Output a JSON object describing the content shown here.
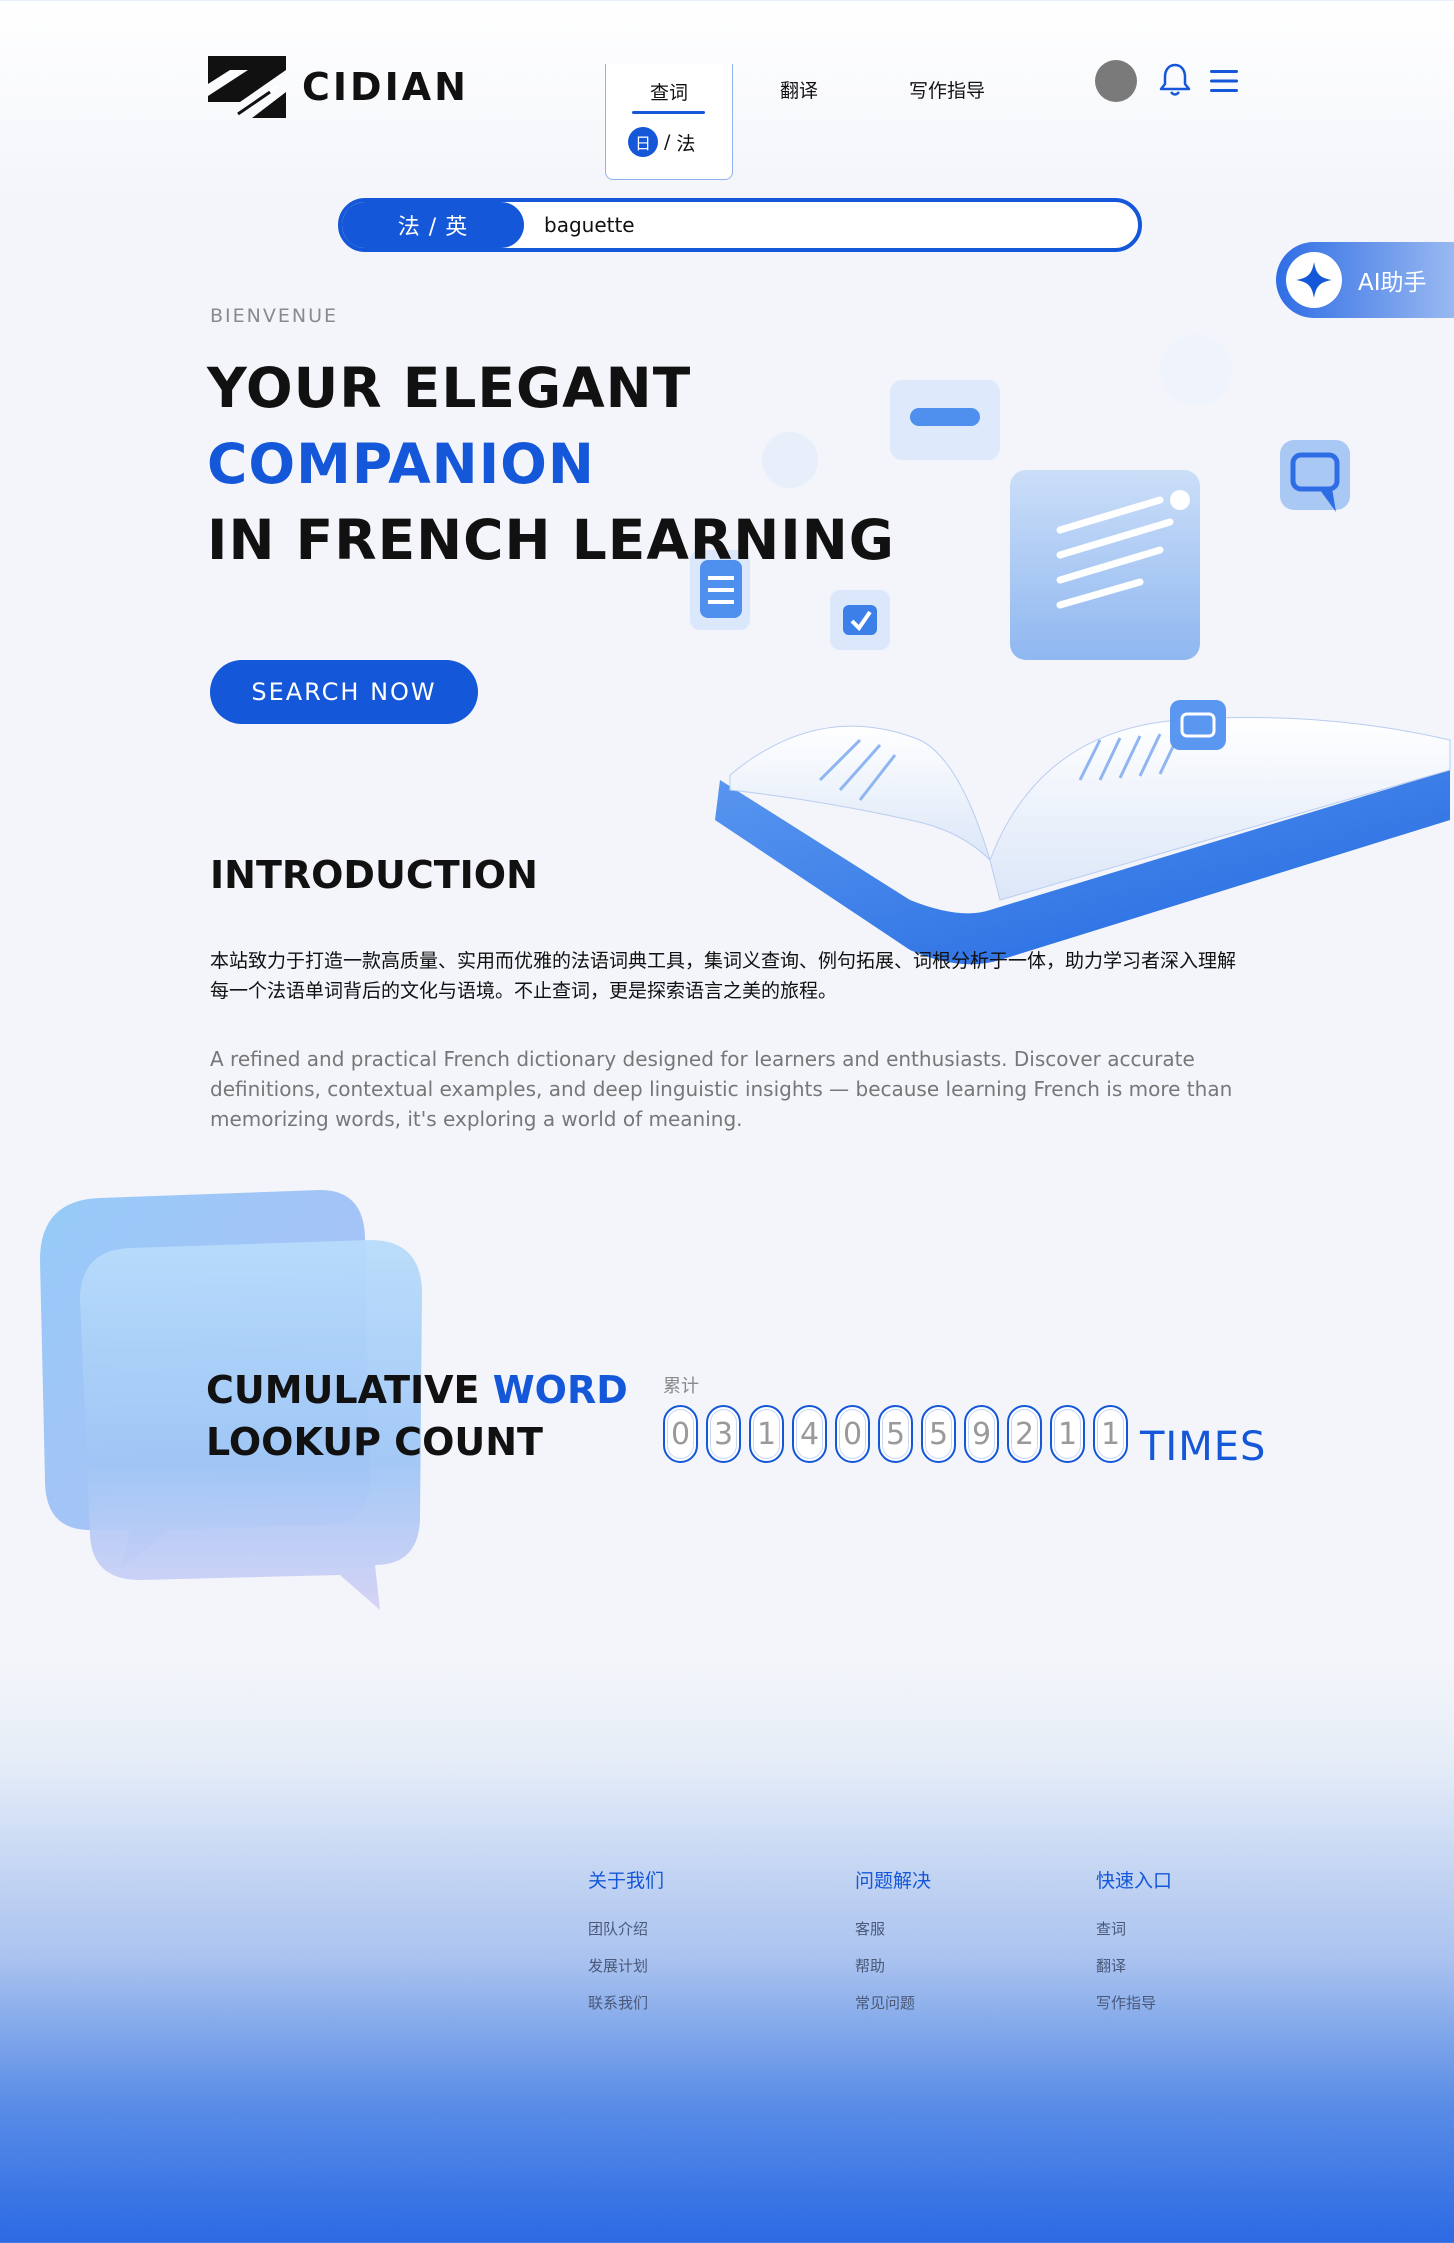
{
  "brand": {
    "name": "CIDIAN"
  },
  "nav": {
    "lookup": "查词",
    "lang_badge": "日",
    "lang_sep": "/",
    "lang_target": "法",
    "translate": "翻译",
    "writing": "写作指导"
  },
  "search": {
    "lang_pair": "法 / 英",
    "value": "baguette"
  },
  "ai_assistant": {
    "label": "AI助手"
  },
  "hero": {
    "eyebrow": "BIENVENUE",
    "line1": "YOUR ELEGANT",
    "line2": "COMPANION",
    "line3": "IN FRENCH LEARNING",
    "cta": "SEARCH NOW"
  },
  "intro": {
    "title": "INTRODUCTION",
    "zh": "本站致力于打造一款高质量、实用而优雅的法语词典工具，集词义查询、例句拓展、词根分析于一体，助力学习者深入理解每一个法语单词背后的文化与语境。不止查词，更是探索语言之美的旅程。",
    "en": "A refined and practical French dictionary designed for learners and enthusiasts. Discover accurate definitions, contextual examples, and deep linguistic insights — because learning French is more than memorizing words, it's exploring a world of meaning."
  },
  "counter": {
    "title_part1": "CUMULATIVE",
    "title_part2": "WORD",
    "title_line2": "LOOKUP COUNT",
    "caption": "累计",
    "digits": [
      "0",
      "3",
      "1",
      "4",
      "0",
      "5",
      "5",
      "9",
      "2",
      "1",
      "1"
    ],
    "unit": "TIMES"
  },
  "footer": {
    "columns": [
      {
        "heading": "关于我们",
        "links": [
          "团队介绍",
          "发展计划",
          "联系我们"
        ]
      },
      {
        "heading": "问题解决",
        "links": [
          "客服",
          "帮助",
          "常见问题"
        ]
      },
      {
        "heading": "快速入口",
        "links": [
          "查词",
          "翻译",
          "写作指导"
        ]
      }
    ]
  },
  "colors": {
    "accent": "#1457d8",
    "text": "#111111",
    "muted": "#8a8a8a"
  }
}
